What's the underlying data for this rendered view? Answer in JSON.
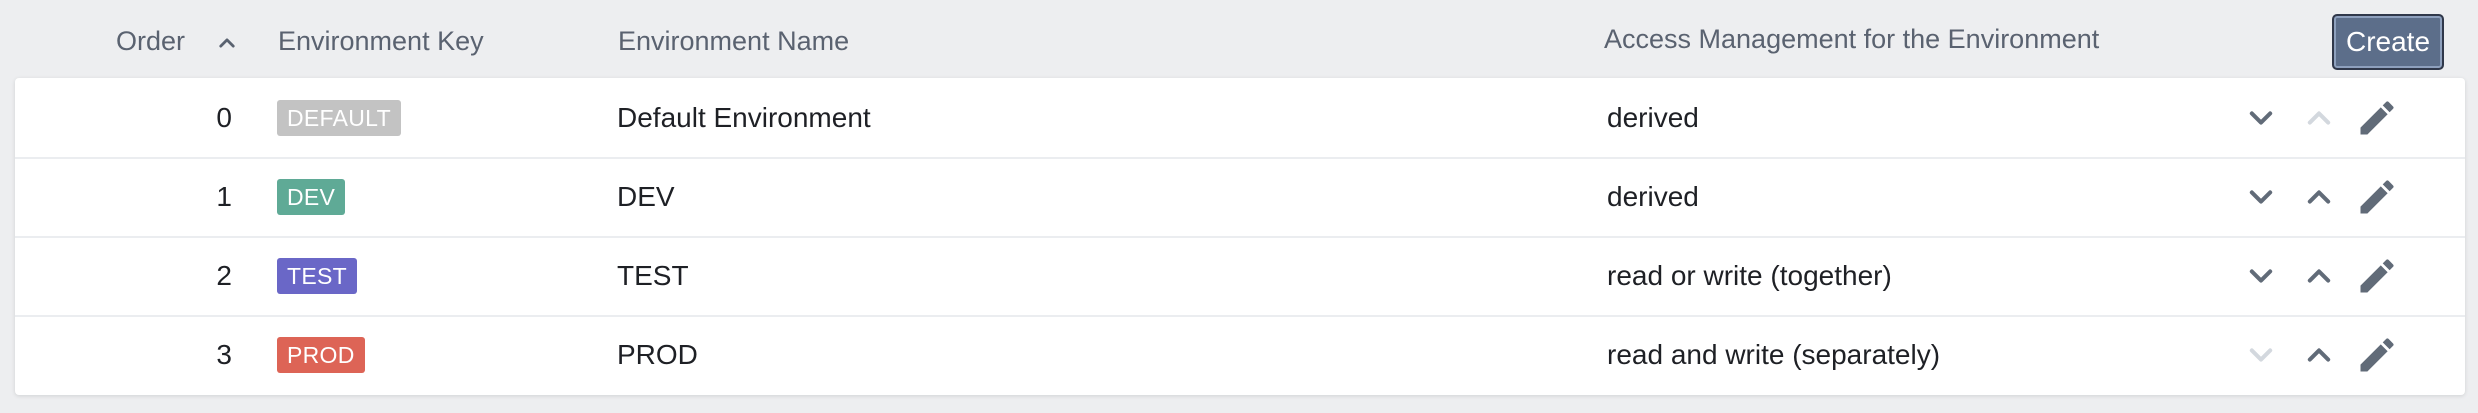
{
  "header": {
    "order_label": "Order",
    "key_label": "Environment Key",
    "name_label": "Environment Name",
    "access_label": "Access Management for the Environment",
    "create_label": "Create",
    "sort_icon": "chevron-up-icon"
  },
  "colors": {
    "header_text": "#5a6270",
    "icon_active": "#616b78",
    "icon_disabled": "#d3d8de",
    "create_button": "#5c6e8a"
  },
  "rows": [
    {
      "order": "0",
      "key": "DEFAULT",
      "key_color": "#c3c3c3",
      "name": "Default Environment",
      "access": "derived",
      "move_down_enabled": true,
      "move_up_enabled": false,
      "icons": [
        "chevron-down-icon",
        "chevron-up-icon",
        "pencil-icon"
      ]
    },
    {
      "order": "1",
      "key": "DEV",
      "key_color": "#5faa96",
      "name": "DEV",
      "access": "derived",
      "move_down_enabled": true,
      "move_up_enabled": true,
      "icons": [
        "chevron-down-icon",
        "chevron-up-icon",
        "pencil-icon"
      ]
    },
    {
      "order": "2",
      "key": "TEST",
      "key_color": "#6a67c7",
      "name": "TEST",
      "access": "read or write (together)",
      "move_down_enabled": true,
      "move_up_enabled": true,
      "icons": [
        "chevron-down-icon",
        "chevron-up-icon",
        "pencil-icon"
      ]
    },
    {
      "order": "3",
      "key": "PROD",
      "key_color": "#dd6456",
      "name": "PROD",
      "access": "read and write (separately)",
      "move_down_enabled": false,
      "move_up_enabled": true,
      "icons": [
        "chevron-down-icon",
        "chevron-up-icon",
        "pencil-icon"
      ]
    }
  ]
}
